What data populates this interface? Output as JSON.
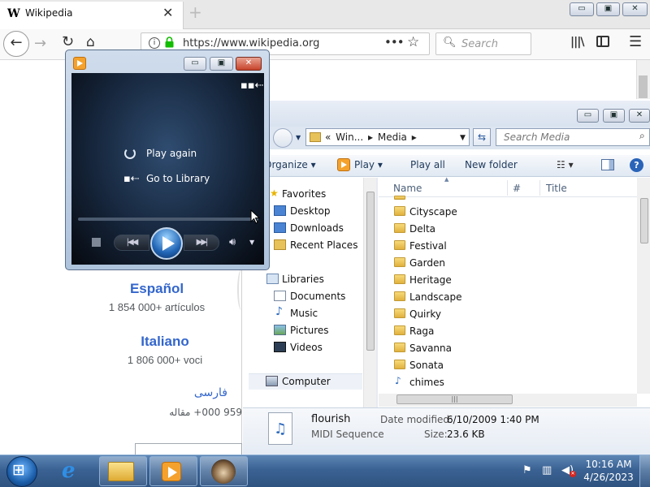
{
  "browser": {
    "tab_title": "Wikipedia",
    "tab_icon": "W",
    "tab_close": "✕",
    "new_tab": "+",
    "url": "https://www.wikipedia.org",
    "search_placeholder": "Search",
    "controls": {
      "min": "▭",
      "max": "▣",
      "close": "✕"
    },
    "languages": [
      {
        "name": "Español",
        "count": "1 854 000+ artículos"
      },
      {
        "name": "Italiano",
        "count": "1 806 000+ voci"
      },
      {
        "name": "فارسی",
        "count": "959 000+ مقاله"
      }
    ]
  },
  "explorer": {
    "breadcrumb": [
      "«",
      "Win...",
      "▸",
      "Media",
      "▸"
    ],
    "search_placeholder": "Search Media",
    "toolbar": {
      "organize": "Organize ▾",
      "play": "Play ▾",
      "play_all": "Play all",
      "new_folder": "New folder",
      "view": "☷ ▾",
      "help": "?"
    },
    "nav": {
      "favorites": "Favorites",
      "desktop": "Desktop",
      "downloads": "Downloads",
      "recent_places": "Recent Places",
      "libraries": "Libraries",
      "documents": "Documents",
      "music": "Music",
      "pictures": "Pictures",
      "videos": "Videos",
      "computer": "Computer"
    },
    "columns": {
      "name": "Name",
      "number": "#",
      "title": "Title"
    },
    "files": [
      {
        "name": "Cityscape",
        "type": "folder"
      },
      {
        "name": "Delta",
        "type": "folder"
      },
      {
        "name": "Festival",
        "type": "folder"
      },
      {
        "name": "Garden",
        "type": "folder"
      },
      {
        "name": "Heritage",
        "type": "folder"
      },
      {
        "name": "Landscape",
        "type": "folder"
      },
      {
        "name": "Quirky",
        "type": "folder"
      },
      {
        "name": "Raga",
        "type": "folder"
      },
      {
        "name": "Savanna",
        "type": "folder"
      },
      {
        "name": "Sonata",
        "type": "folder"
      },
      {
        "name": "chimes",
        "type": "audio"
      }
    ],
    "details": {
      "name": "flourish",
      "type": "MIDI Sequence",
      "modified_label": "Date modified:",
      "modified_value": "6/10/2009 1:40 PM",
      "size_label": "Size:",
      "size_value": "23.6 KB"
    }
  },
  "media_player": {
    "play_again": "Play again",
    "go_to_library": "Go to Library",
    "prev": "|◀◀",
    "next": "▶▶|"
  },
  "taskbar": {
    "time": "10:16 AM",
    "date": "4/26/2023"
  },
  "colors": {
    "wiki_link": "#3366cc",
    "taskbar": "#3a6293",
    "player_bg": "#16263c"
  }
}
